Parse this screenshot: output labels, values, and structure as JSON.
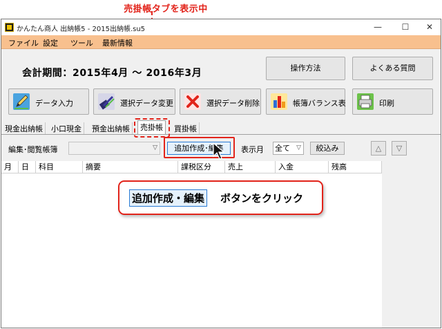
{
  "annotation": {
    "top_label": "売掛帳タブを表示中",
    "callout_button_label": "追加作成・編集",
    "callout_text": "ボタンをクリック"
  },
  "window": {
    "title": "かんたん商人 出納帳5 - 2015出納帳.su5",
    "controls": {
      "minimize": "—",
      "maximize": "☐",
      "close": "✕"
    }
  },
  "menu": [
    "ファイル",
    "設定",
    "ツール",
    "最新情報"
  ],
  "period": "会計期間：2015年4月 〜 2016年3月",
  "top_buttons": {
    "how_to": "操作方法",
    "faq": "よくある質問"
  },
  "toolbar": [
    {
      "label": "データ入力",
      "icon": "pencil-icon"
    },
    {
      "label": "選択データ変更",
      "icon": "pen-edit-icon"
    },
    {
      "label": "選択データ削除",
      "icon": "delete-x-icon"
    },
    {
      "label": "帳簿バランス表",
      "icon": "bar-chart-icon"
    },
    {
      "label": "印刷",
      "icon": "printer-icon"
    }
  ],
  "tabs": [
    "現金出納帳",
    "小口現金",
    "預金出納帳",
    "売掛帳",
    "買掛帳"
  ],
  "active_tab": "売掛帳",
  "filter": {
    "ledger_label": "編集･閲覧帳簿",
    "ledger_value": "",
    "add_edit_button": "追加作成･編集",
    "month_label": "表示月",
    "month_value": "全て",
    "narrow_button": "絞込み",
    "up_button": "△",
    "down_button": "▽"
  },
  "grid_columns": [
    "月",
    "日",
    "科目",
    "摘要",
    "課税区分",
    "売上",
    "入金",
    "残高"
  ],
  "colors": {
    "accent_red": "#e2231a",
    "menu_bg": "#f8c08e",
    "focus_blue": "#2a7bd4"
  }
}
